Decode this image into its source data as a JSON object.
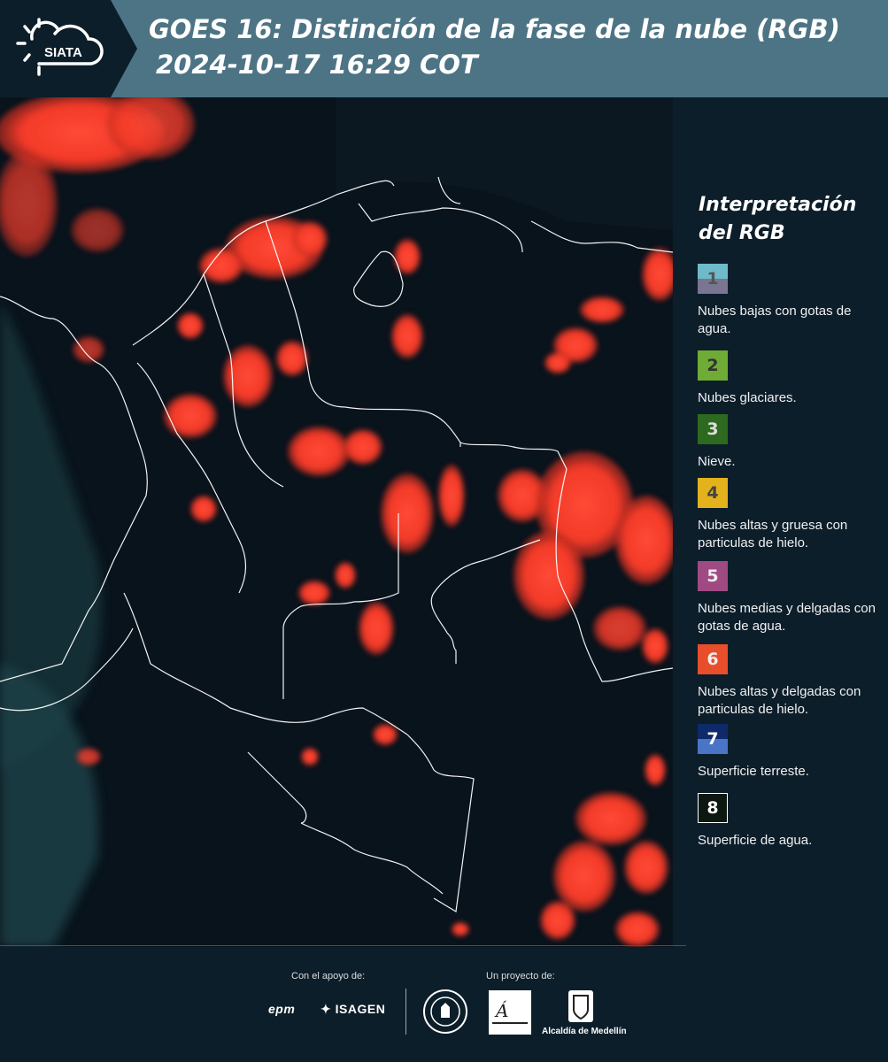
{
  "header": {
    "logo_text": "SIATA",
    "title": "GOES 16: Distinción de la fase de la nube (RGB)",
    "timestamp": "2024-10-17 16:29 COT",
    "bg_color": "#4d7485"
  },
  "legend": {
    "title": "Interpretación del RGB",
    "items": [
      {
        "number": "1",
        "label": "Nubes bajas con gotas de agua.",
        "color_top": "#6ebac9",
        "color_bottom": "#7a7590"
      },
      {
        "number": "2",
        "label": "Nubes glaciares.",
        "color": "#6fac36"
      },
      {
        "number": "3",
        "label": "Nieve.",
        "color": "#2d6a1f"
      },
      {
        "number": "4",
        "label": "Nubes altas y gruesa con particulas de hielo.",
        "color": "#e3b21d"
      },
      {
        "number": "5",
        "label": "Nubes medias y delgadas con gotas de agua.",
        "color": "#a04a84"
      },
      {
        "number": "6",
        "label": "Nubes altas y delgadas con particulas de hielo.",
        "color": "#e84e2b"
      },
      {
        "number": "7",
        "label": "Superficie terreste.",
        "color_top": "#0f2a6a",
        "color_bottom": "#4a74c6"
      },
      {
        "number": "8",
        "label": "Superficie de agua.",
        "color": "#0b1710"
      }
    ]
  },
  "footer": {
    "support_label": "Con el apoyo de:",
    "project_label": "Un proyecto de:",
    "sponsors": [
      "epm",
      "ISAGEN"
    ],
    "partners": [
      "Área Metropolitana Valle de Aburrá",
      "Alcaldía de Medellín"
    ],
    "alcaldia_text": "Alcaldía de Medellín"
  },
  "map": {
    "cloud_color": "#ff3a2a",
    "land_color": "#0f1d2a",
    "border_color": "#ffffff"
  }
}
